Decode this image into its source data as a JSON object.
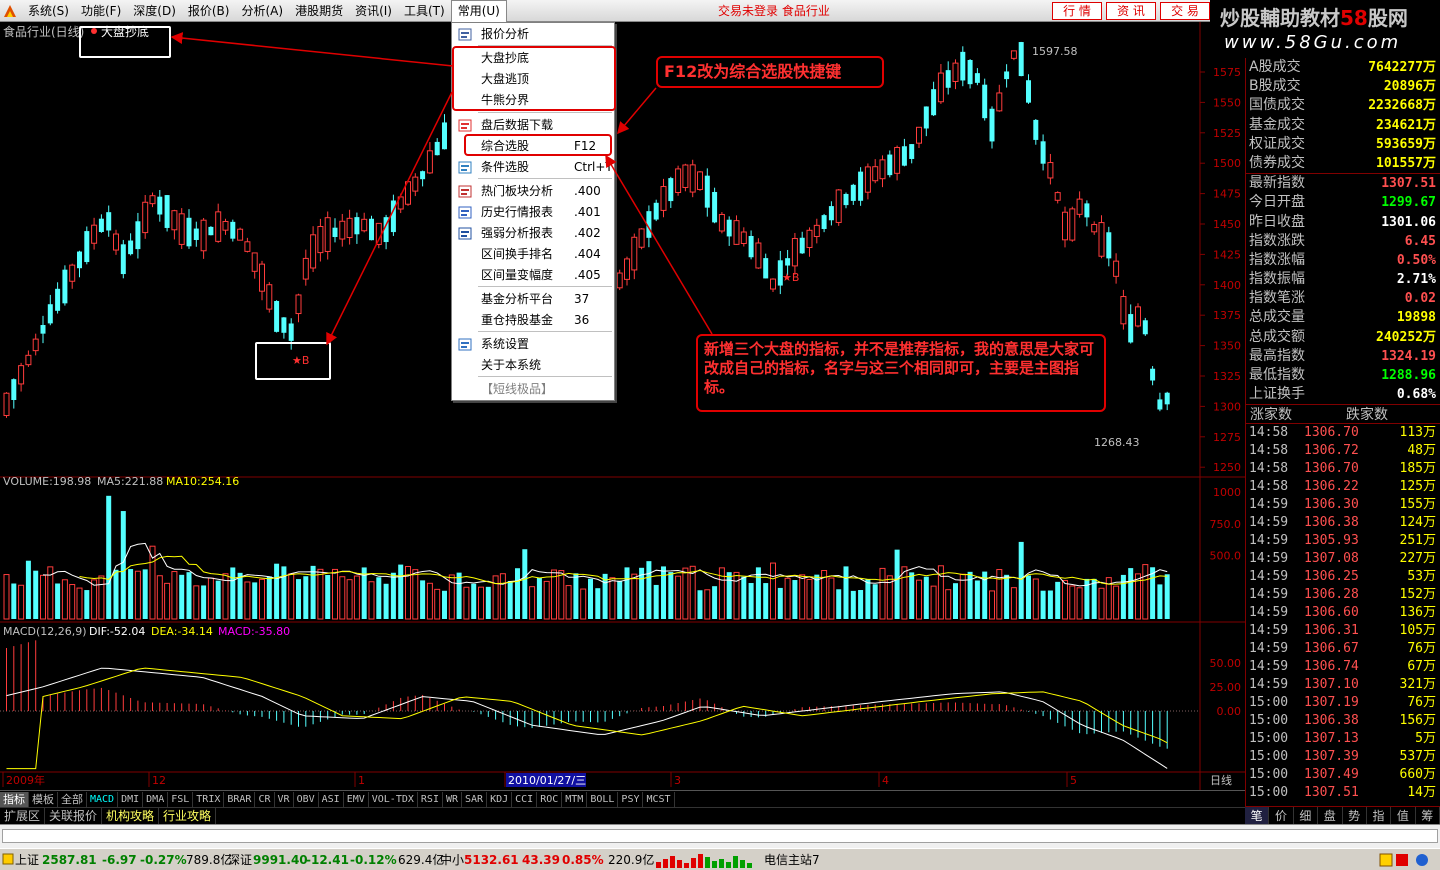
{
  "menubar": {
    "items": [
      "系统(S)",
      "功能(F)",
      "深度(D)",
      "报价(B)",
      "分析(A)",
      "港股期货",
      "资讯(I)",
      "工具(T)",
      "常用(U)"
    ],
    "status_text": "交易未登录  食品行业",
    "right_tabs": [
      "行 情",
      "资 讯",
      "交 易"
    ]
  },
  "banner": {
    "title_prefix": "炒股輔助教材",
    "title_highlight": "58",
    "title_suffix": "股网",
    "url": "www.58Gu.com"
  },
  "chart": {
    "title": "食品行业(日线)",
    "indicator_label": "大盘抄底",
    "high_label": "1597.58",
    "low_label": "1268.43",
    "price_ticks": [
      "1575",
      "1550",
      "1525",
      "1500",
      "1475",
      "1450",
      "1425",
      "1400",
      "1375",
      "1350",
      "1325",
      "1300",
      "1275",
      "1250"
    ],
    "volume_header": {
      "vol": "VOLUME:198.98",
      "ma5": "MA5:221.88",
      "ma10": "MA10:254.16"
    },
    "volume_ticks": [
      "1000",
      "750.0",
      "500.0"
    ],
    "macd_header": {
      "name": "MACD(12,26,9)",
      "dif": "DIF:-52.04",
      "dea": "DEA:-34.14",
      "macd": "MACD:-35.80"
    },
    "macd_ticks": [
      "50.00",
      "25.00",
      "0.00"
    ],
    "date_labels": [
      "2009年",
      "12",
      "1",
      "2010/01/27/三",
      "3",
      "4",
      "5"
    ],
    "period_label": "日线",
    "signal_marks": [
      "★B",
      "★B"
    ]
  },
  "dropdown": {
    "items": [
      {
        "label": "报价分析",
        "key": "",
        "icon": "grid-icon"
      },
      {
        "label": "大盘抄底",
        "key": "",
        "icon": ""
      },
      {
        "label": "大盘逃顶",
        "key": "",
        "icon": ""
      },
      {
        "label": "牛熊分界",
        "key": "",
        "icon": ""
      },
      {
        "label": "盘后数据下载",
        "key": "",
        "icon": "download-icon"
      },
      {
        "label": "综合选股",
        "key": "F12",
        "icon": ""
      },
      {
        "label": "条件选股",
        "key": "Ctrl+T",
        "icon": "filter-icon"
      },
      {
        "label": "热门板块分析",
        "key": ".400",
        "icon": "sector-icon"
      },
      {
        "label": "历史行情报表",
        "key": ".401",
        "icon": "history-icon"
      },
      {
        "label": "强弱分析报表",
        "key": ".402",
        "icon": "strength-icon"
      },
      {
        "label": "区间换手排名",
        "key": ".404",
        "icon": ""
      },
      {
        "label": "区间量变幅度",
        "key": ".405",
        "icon": ""
      },
      {
        "label": "基金分析平台",
        "key": "37",
        "icon": ""
      },
      {
        "label": "重仓持股基金",
        "key": "36",
        "icon": ""
      },
      {
        "label": "系统设置",
        "key": "",
        "icon": "settings-icon"
      },
      {
        "label": "关于本系统",
        "key": "",
        "icon": ""
      },
      {
        "label": "【短线极品】",
        "key": "",
        "icon": ""
      }
    ]
  },
  "annotations": {
    "f12_note": "F12改为综合选股快捷键",
    "main_note": "新增三个大盘的指标，并不是推荐指标，我的意思是大家可改成自己的指标，名字与这三个相同即可，主要是主图指标。"
  },
  "quote": {
    "rows": [
      {
        "label": "A股成交",
        "value": "7642277万",
        "color": "#ffff00"
      },
      {
        "label": "B股成交",
        "value": "20896万",
        "color": "#ffff00"
      },
      {
        "label": "国债成交",
        "value": "2232668万",
        "color": "#ffff00"
      },
      {
        "label": "基金成交",
        "value": "234621万",
        "color": "#ffff00"
      },
      {
        "label": "权证成交",
        "value": "593659万",
        "color": "#ffff00"
      },
      {
        "label": "债券成交",
        "value": "101557万",
        "color": "#ffff00"
      },
      {
        "label": "最新指数",
        "value": "1307.51",
        "color": "#ff5050"
      },
      {
        "label": "今日开盘",
        "value": "1299.67",
        "color": "#00ff00"
      },
      {
        "label": "昨日收盘",
        "value": "1301.06",
        "color": "#ffffff"
      },
      {
        "label": "指数涨跌",
        "value": "6.45",
        "color": "#ff5050"
      },
      {
        "label": "指数涨幅",
        "value": "0.50%",
        "color": "#ff5050"
      },
      {
        "label": "指数振幅",
        "value": "2.71%",
        "color": "#ffffff"
      },
      {
        "label": "指数笔涨",
        "value": "0.02",
        "color": "#ff5050"
      },
      {
        "label": "总成交量",
        "value": "19898",
        "color": "#ffff00"
      },
      {
        "label": "总成交额",
        "value": "240252万",
        "color": "#ffff00"
      },
      {
        "label": "最高指数",
        "value": "1324.19",
        "color": "#ff5050"
      },
      {
        "label": "最低指数",
        "value": "1288.96",
        "color": "#00ff00"
      },
      {
        "label": "上证换手",
        "value": "0.68%",
        "color": "#ffffff"
      }
    ],
    "up_label": "涨家数",
    "down_label": "跌家数"
  },
  "trades": [
    [
      "14:58",
      "1306.70",
      "113万"
    ],
    [
      "14:58",
      "1306.72",
      "48万"
    ],
    [
      "14:58",
      "1306.70",
      "185万"
    ],
    [
      "14:58",
      "1306.22",
      "125万"
    ],
    [
      "14:59",
      "1306.30",
      "155万"
    ],
    [
      "14:59",
      "1306.38",
      "124万"
    ],
    [
      "14:59",
      "1305.93",
      "251万"
    ],
    [
      "14:59",
      "1307.08",
      "227万"
    ],
    [
      "14:59",
      "1306.25",
      "53万"
    ],
    [
      "14:59",
      "1306.28",
      "152万"
    ],
    [
      "14:59",
      "1306.60",
      "136万"
    ],
    [
      "14:59",
      "1306.31",
      "105万"
    ],
    [
      "14:59",
      "1306.67",
      "76万"
    ],
    [
      "14:59",
      "1306.74",
      "67万"
    ],
    [
      "14:59",
      "1307.10",
      "321万"
    ],
    [
      "15:00",
      "1307.19",
      "76万"
    ],
    [
      "15:00",
      "1306.38",
      "156万"
    ],
    [
      "15:00",
      "1307.13",
      "5万"
    ],
    [
      "15:00",
      "1307.39",
      "537万"
    ],
    [
      "15:00",
      "1307.49",
      "660万"
    ],
    [
      "15:00",
      "1307.51",
      "14万"
    ]
  ],
  "bottom_tabs": {
    "row1_fixed": [
      "指标",
      "模板",
      "全部"
    ],
    "indicators": [
      "MACD",
      "DMI",
      "DMA",
      "FSL",
      "TRIX",
      "BRAR",
      "CR",
      "VR",
      "OBV",
      "ASI",
      "EMV",
      "VOL-TDX",
      "RSI",
      "WR",
      "SAR",
      "KDJ",
      "CCI",
      "ROC",
      "MTM",
      "BOLL",
      "PSY",
      "MCST"
    ],
    "row2": [
      "扩展区",
      "关联报价",
      "机构攻略",
      "行业攻略"
    ],
    "right_tabs": [
      "笔",
      "价",
      "细",
      "盘",
      "势",
      "指",
      "值",
      "筹"
    ]
  },
  "statusbar": {
    "sh_label": "上证",
    "sh_value": "2587.81",
    "sh_change": "-6.97",
    "sh_pct": "-0.27%",
    "sh_amount": "789.8亿",
    "sz_label": "深证",
    "sz_value": "9991.40",
    "sz_change": "-12.41",
    "sz_pct": "-0.12%",
    "sz_amount": "629.4亿",
    "zx_label": "中小",
    "zx_value": "5132.61",
    "zx_change": "43.39",
    "zx_pct": "0.85%",
    "zx_amount": "220.9亿",
    "server": "电信主站7"
  }
}
